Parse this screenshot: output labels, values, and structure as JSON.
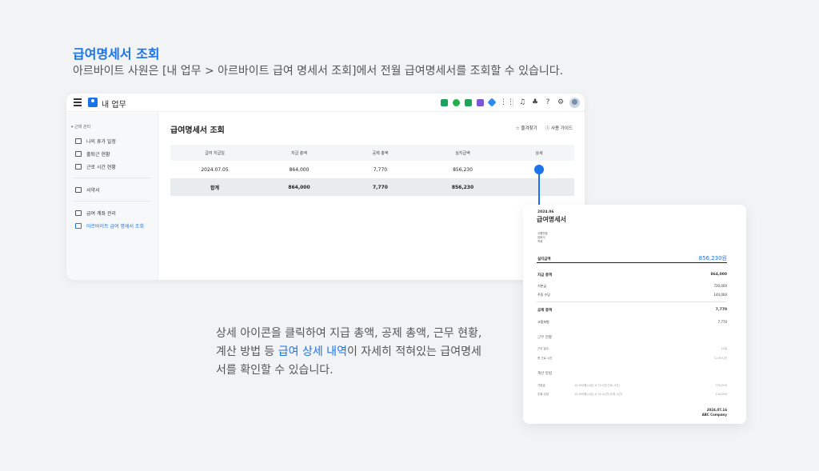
{
  "hero": {
    "title": "급여명세서 조회",
    "subtitle": "아르바이트 사원은 [내 업무 > 아르바이트 급여 명세서 조회]에서 전월 급여명세서를 조회할 수 있습니다."
  },
  "topbar": {
    "title": "내 업무",
    "app_icon_colors": [
      "#1aa260",
      "#23b14d",
      "#22a35a",
      "#7b57d6",
      "#2d8cf0"
    ]
  },
  "sidebar": {
    "group": "근태 관리",
    "items": [
      {
        "label": "나의 휴가 일정",
        "icon": "calendar-icon"
      },
      {
        "label": "출퇴근 현황",
        "icon": "briefcase-icon"
      },
      {
        "label": "근로 시간 현황",
        "icon": "monitor-icon"
      },
      {
        "label": "서약서",
        "icon": "edit-document-icon"
      },
      {
        "label": "급여 계좌 관리",
        "icon": "bankbook-icon"
      },
      {
        "label": "아르바이트 급여 명세서 조회",
        "icon": "payslip-icon"
      }
    ]
  },
  "page": {
    "title": "급여명세서 조회",
    "favorite": "즐겨찾기",
    "guide": "사용 가이드"
  },
  "table": {
    "headers": [
      "급여 지급일",
      "지급 총액",
      "공제 총액",
      "실지급액",
      "상세"
    ],
    "row": {
      "date": "2024.07.05",
      "gross": "864,000",
      "deduction": "7,770",
      "net": "856,230"
    },
    "summary": {
      "label": "합계",
      "gross": "864,000",
      "deduction": "7,770",
      "net": "856,230"
    }
  },
  "slip": {
    "period": "2024.06",
    "title": "급여명세서",
    "meta_labels": [
      "사원번호",
      "입퇴사",
      "직위"
    ],
    "net_label": "실지급액",
    "net_amount": "856,230원",
    "gross_label": "지급 총액",
    "gross_amount": "864,000",
    "gross_items": [
      {
        "label": "기본급",
        "value": "720,000"
      },
      {
        "label": "주휴 수당",
        "value": "144,000"
      }
    ],
    "deduction_label": "공제 총액",
    "deduction_amount": "7,770",
    "deduction_items": [
      {
        "label": "고용보험",
        "value": "7,770"
      }
    ],
    "work_section": "근무 현황",
    "work_items": [
      {
        "label": "근무 일수",
        "value": "12일"
      },
      {
        "label": "총 근로 시간",
        "value": "72.00시간"
      }
    ],
    "calc_section": "계산 방법",
    "calc_items": [
      {
        "label": "기본급",
        "formula": "10,000원(시급) X 72시간(근로 시간)",
        "value": "720,000"
      },
      {
        "label": "주휴 수당",
        "formula": "10,000원(시급) X 14.4시간(주휴 시간)",
        "value": "144,000"
      }
    ],
    "date": "2024.07.16",
    "company": "ABC Company"
  },
  "description": {
    "line1": "상세 아이콘을 클릭하여 지급 총액, 공제 총액, 근무 현황,",
    "line2_pre": "계산 방법 등 ",
    "line2_hl": "급여 상세 내역",
    "line2_post": "이 자세히 적혀있는 급여명세",
    "line3": "서를 확인할 수 있습니다."
  }
}
